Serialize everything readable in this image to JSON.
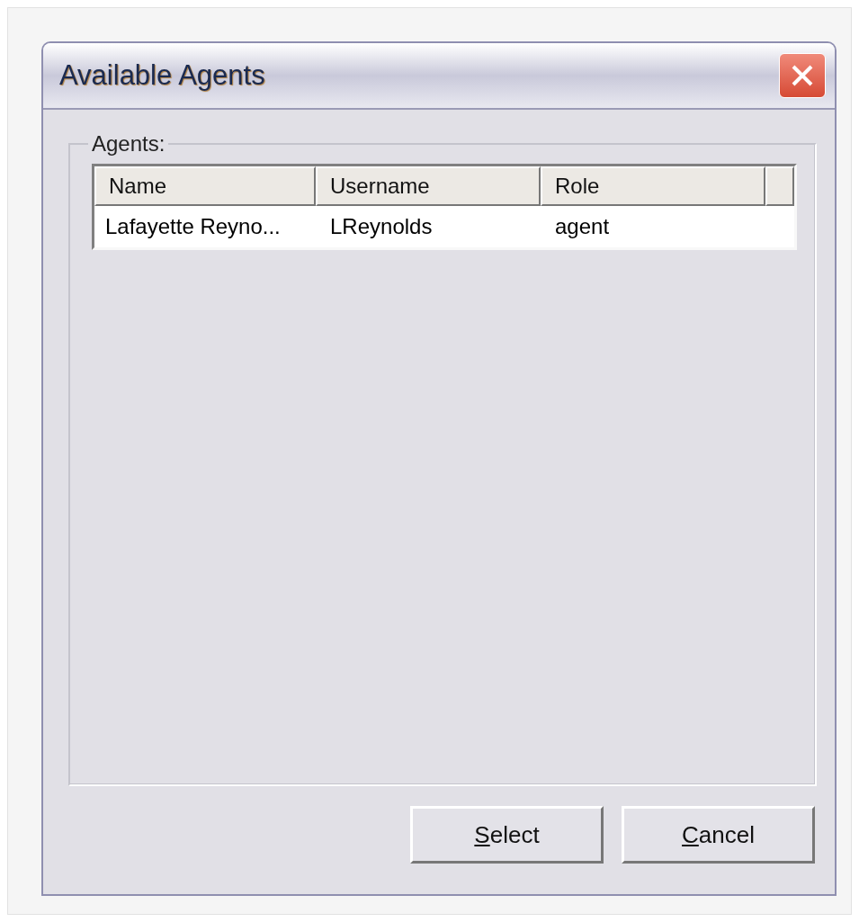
{
  "window": {
    "title": "Available Agents"
  },
  "group": {
    "label": "Agents:"
  },
  "table": {
    "columns": [
      "Name",
      "Username",
      "Role"
    ],
    "rows": [
      {
        "cells": [
          "Lafayette Reyno...",
          "LReynolds",
          "agent"
        ],
        "selected": false
      }
    ]
  },
  "buttons": [
    {
      "label": "Select",
      "underline_first": true
    },
    {
      "label": "Cancel",
      "underline_first": true
    }
  ]
}
